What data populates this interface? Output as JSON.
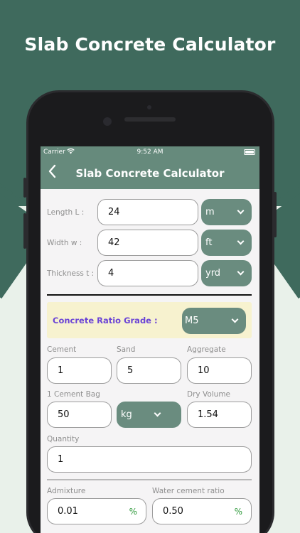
{
  "headline": "Slab Concrete Calculator",
  "status_bar": {
    "carrier": "Carrier",
    "time": "9:52 AM"
  },
  "nav": {
    "back_icon": "chevron-left-icon",
    "title": "Slab Concrete Calculator"
  },
  "dimensions": [
    {
      "label": "Length L :",
      "value": "24",
      "unit": "m"
    },
    {
      "label": "Width w :",
      "value": "42",
      "unit": "ft"
    },
    {
      "label": "Thickness t :",
      "value": "4",
      "unit": "yrd"
    }
  ],
  "grade": {
    "label": "Concrete Ratio Grade :",
    "value": "M5"
  },
  "ratio": {
    "cement_label": "Cement",
    "cement_value": "1",
    "sand_label": "Sand",
    "sand_value": "5",
    "aggregate_label": "Aggregate",
    "aggregate_value": "10"
  },
  "bag": {
    "label": "1 Cement Bag",
    "value": "50",
    "unit": "kg",
    "dry_volume_label": "Dry  Volume",
    "dry_volume_value": "1.54"
  },
  "quantity": {
    "label": "Quantity",
    "value": "1"
  },
  "admixture": {
    "label": "Admixture",
    "value": "0.01",
    "unit": "%"
  },
  "water_cement": {
    "label": "Water cement ratio",
    "value": "0.50",
    "unit": "%"
  },
  "colors": {
    "primary": "#3f6a5d",
    "header": "#668a7c",
    "dropdown": "#6a8c7f",
    "grade_bg": "#f7f2cf",
    "grade_text": "#6a43d6",
    "percent": "#2f9a3c"
  }
}
